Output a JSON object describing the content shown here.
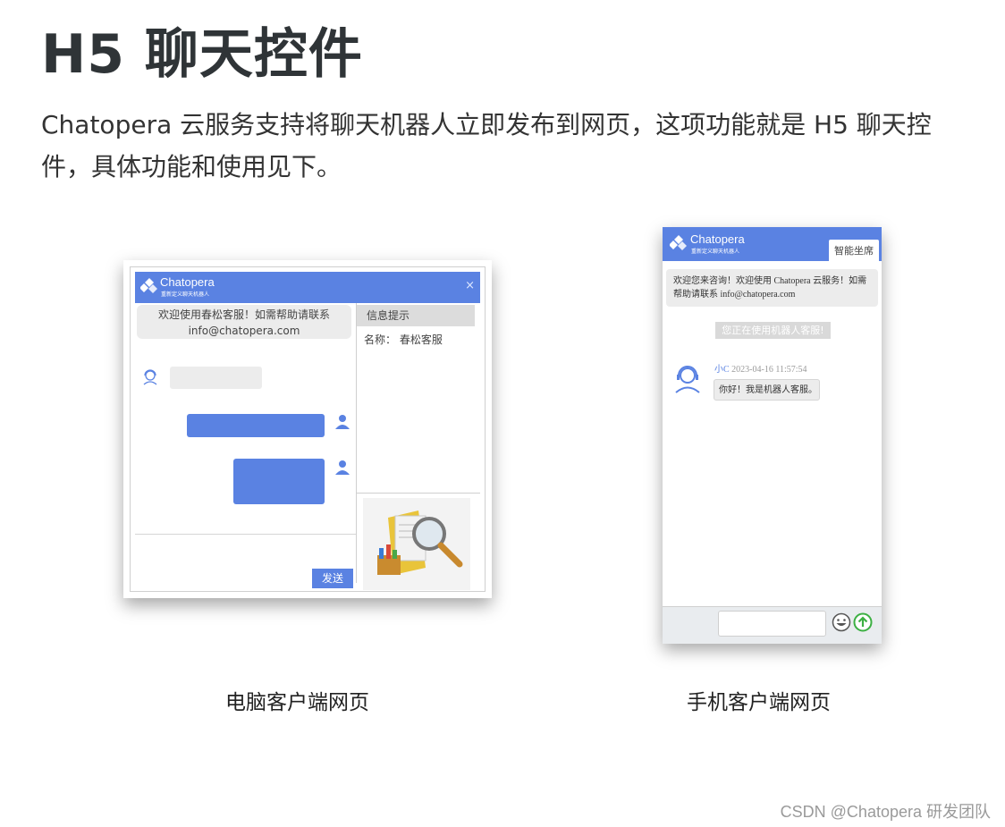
{
  "heading": "H5 聊天控件",
  "intro": "Chatopera 云服务支持将聊天机器人立即发布到网页，这项功能就是 H5 聊天控件，具体功能和使用见下。",
  "desktop": {
    "brand": "Chatopera",
    "brand_sub": "重新定义聊天机器人",
    "close": "×",
    "welcome_line1": "欢迎使用春松客服！如需帮助请联系",
    "welcome_line2": "info@chatopera.com",
    "side_header": "信息提示",
    "side_name": "名称：  春松客服",
    "send_label": "发送",
    "caption": "电脑客户端网页"
  },
  "mobile": {
    "brand": "Chatopera",
    "brand_sub": "重新定义聊天机器人",
    "tab": "智能坐席",
    "welcome": "欢迎您来咨询！欢迎使用 Chatopera 云服务！如需帮助请联系 info@chatopera.com",
    "notice": "您正在使用机器人客服!",
    "sender": "小C",
    "timestamp": "2023-04-16 11:57:54",
    "message": "你好！我是机器人客服。",
    "caption": "手机客户端网页"
  },
  "watermark": "CSDN @Chatopera 研发团队",
  "colors": {
    "accent": "#5a82e2",
    "bubble": "#ececec",
    "send_icon": "#3cb043"
  }
}
